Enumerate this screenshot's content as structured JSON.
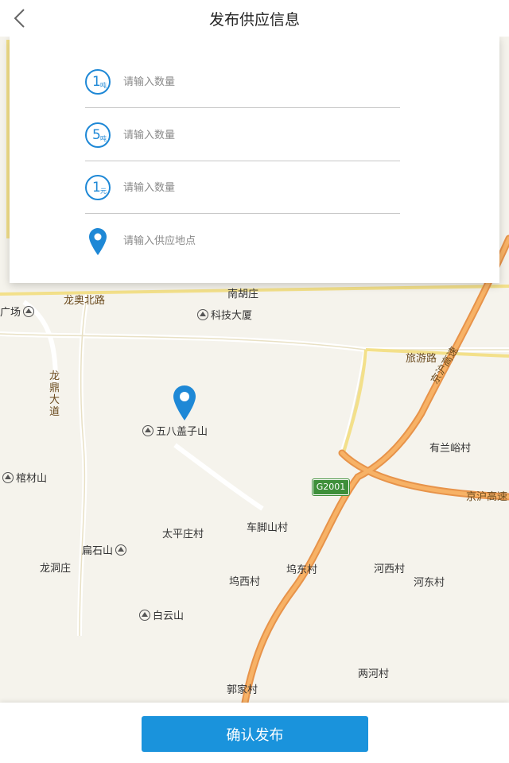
{
  "header": {
    "title": "发布供应信息"
  },
  "form": {
    "rows": [
      {
        "icon_number": "1",
        "icon_unit": "吨",
        "placeholder": "请输入数量"
      },
      {
        "icon_number": "5",
        "icon_unit": "吨",
        "placeholder": "请输入数量"
      },
      {
        "icon_number": "1",
        "icon_unit": "元",
        "placeholder": "请输入数量"
      },
      {
        "icon": "location-pin-icon",
        "placeholder": "请输入供应地点"
      }
    ]
  },
  "map": {
    "labels": {
      "nanhuzhuang": "南胡庄",
      "longao_road": "龙奥北路",
      "guangchang": "广场",
      "keji_dasha": "科技大厦",
      "lvyou_road": "旅游路",
      "longding_road": "龙鼎大道",
      "wubagaizi": "五八盖子山",
      "jinghu_gaosu_1": "京沪高速",
      "youlanyu": "有兰峪村",
      "guocai": "棺材山",
      "jinghu_gaosu_2": "京沪高速",
      "shield": "G2001",
      "chejiaoshan": "车脚山村",
      "taipingzhuang": "太平庄村",
      "bianshi": "扁石山",
      "longdongzhuang": "龙洞庄",
      "wuxi": "坞西村",
      "wudong": "坞东村",
      "hexi": "河西村",
      "hedong": "河东村",
      "baiyun": "白云山",
      "lianghe": "两河村",
      "guojia": "郭家村"
    }
  },
  "footer": {
    "confirm_label": "确认发布"
  },
  "colors": {
    "accent": "#1a93dc",
    "icon_blue": "#1e88d6",
    "highway": "#f2a04a"
  }
}
